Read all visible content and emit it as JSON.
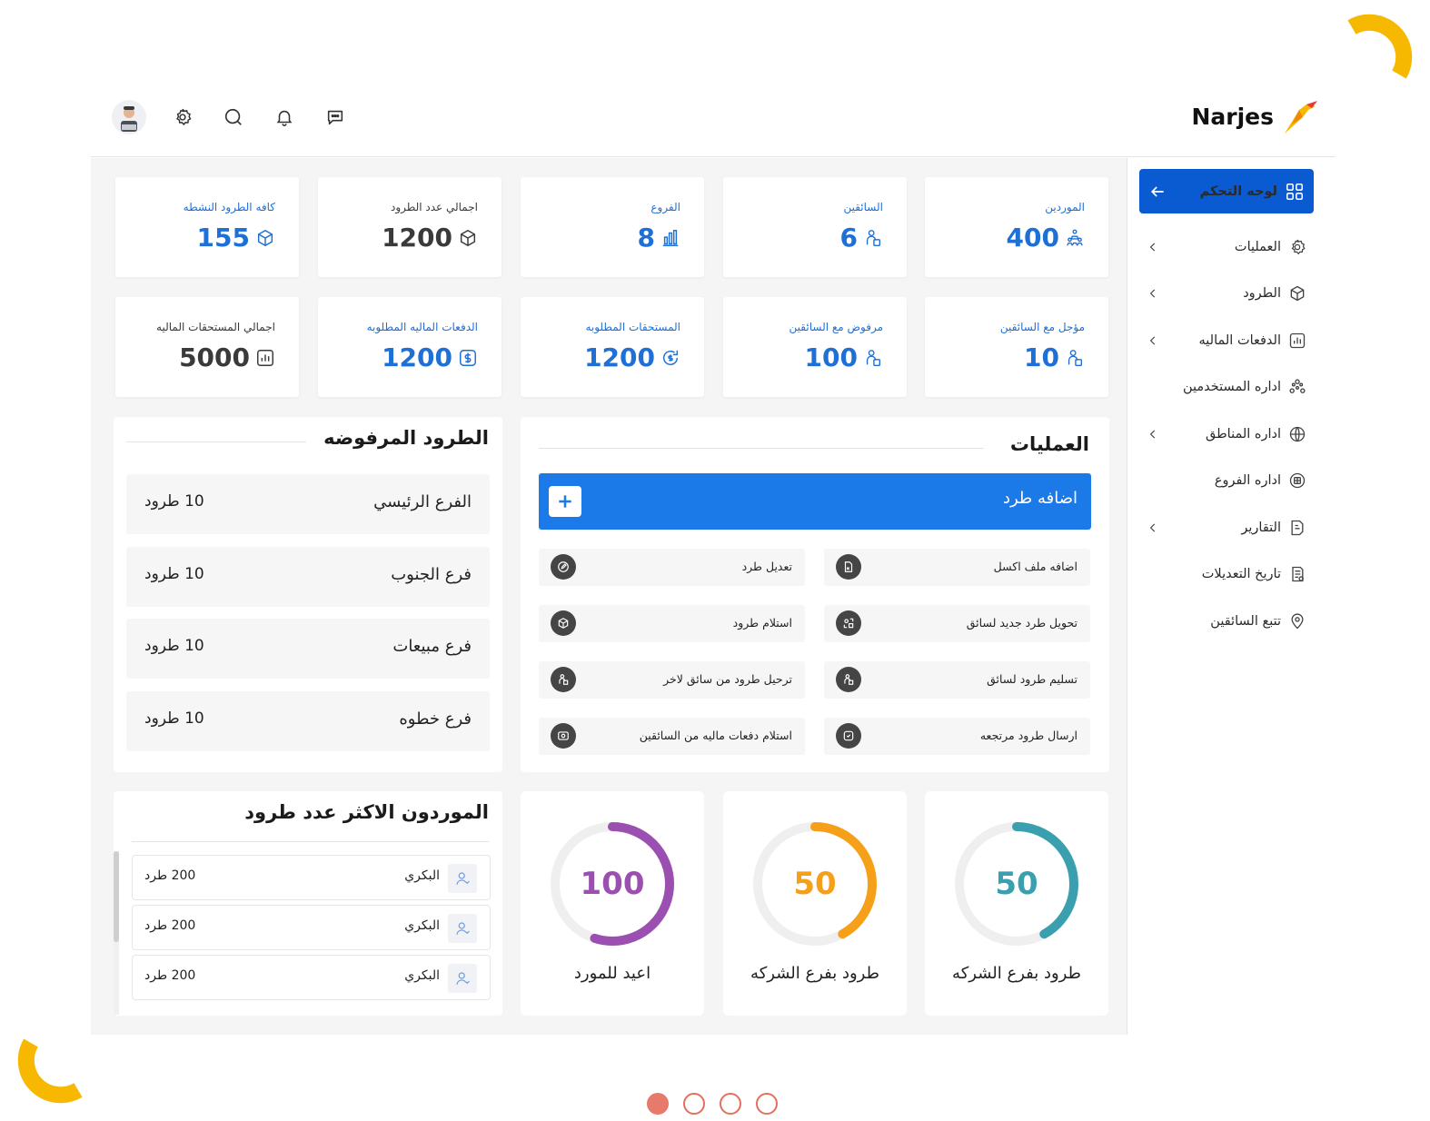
{
  "brand": {
    "name": "Narjes"
  },
  "header": {
    "icons": [
      "avatar",
      "gear-icon",
      "search-icon",
      "bell-icon",
      "chat-icon"
    ]
  },
  "colors": {
    "primary": "#0a5ad1",
    "button": "#1b7ae8",
    "stat_blue": "#1e6fd6",
    "teal": "#3aa0b0",
    "orange": "#f6a01a",
    "purple": "#9b4fb0",
    "accent_yellow": "#f6b800",
    "pager": "#e77a6a"
  },
  "sidebar": {
    "items": [
      {
        "label": "لوحه التحكم",
        "icon": "grid-icon",
        "active": true
      },
      {
        "label": "العمليات",
        "icon": "gear-icon",
        "has_children": true
      },
      {
        "label": "الطرود",
        "icon": "box-icon",
        "has_children": true
      },
      {
        "label": "الدفعات الماليه",
        "icon": "chart-icon",
        "has_children": true
      },
      {
        "label": "اداره المستخدمين",
        "icon": "users-icon",
        "has_children": false
      },
      {
        "label": "اداره المناطق",
        "icon": "globe-icon",
        "has_children": true
      },
      {
        "label": "اداره الفروع",
        "icon": "branch-icon",
        "has_children": false
      },
      {
        "label": "التقارير",
        "icon": "report-icon",
        "has_children": true
      },
      {
        "label": "تاريخ التعديلات",
        "icon": "history-icon",
        "has_children": false
      },
      {
        "label": "تتبع السائقين",
        "icon": "location-icon",
        "has_children": false
      }
    ]
  },
  "stats_row1": [
    {
      "title": "الموردين",
      "value": "400",
      "icon": "suppliers-icon"
    },
    {
      "title": "السائقين",
      "value": "6",
      "icon": "driver-icon"
    },
    {
      "title": "الفروع",
      "value": "8",
      "icon": "bars-icon"
    },
    {
      "title": "اجمالي عدد الطرود",
      "value": "1200",
      "icon": "box-icon"
    },
    {
      "title": "كافه الطرود النشطه",
      "value": "155",
      "icon": "box-icon"
    }
  ],
  "stats_row2": [
    {
      "title": "مؤجل مع السائقين",
      "value": "10",
      "icon": "driver-icon"
    },
    {
      "title": "مرفوض مع السائقين",
      "value": "100",
      "icon": "driver-icon"
    },
    {
      "title": "المستحقات المطلوبه",
      "value": "1200",
      "icon": "refresh-dollar-icon"
    },
    {
      "title": "الدفعات الماليه المطلوبه",
      "value": "1200",
      "icon": "dollar-icon"
    },
    {
      "title": "اجمالي المستحقات الماليه",
      "value": "5000",
      "icon": "chart-icon"
    }
  ],
  "operations": {
    "title": "العمليات",
    "add_label": "اضافه طرد",
    "items": [
      {
        "label": "اضافه ملف اكسل",
        "icon": "file-icon"
      },
      {
        "label": "تعديل طرد",
        "icon": "edit-icon"
      },
      {
        "label": "تحويل طرد جديد لسائق",
        "icon": "transfer-icon"
      },
      {
        "label": "استلام طرود",
        "icon": "box-icon"
      },
      {
        "label": "تسليم طرود لسائق",
        "icon": "driver-icon"
      },
      {
        "label": "ترحيل طرود من سائق لاخر",
        "icon": "driver-icon"
      },
      {
        "label": "ارسال طرود مرتجعه",
        "icon": "return-icon"
      },
      {
        "label": "استلام دفعات ماليه من السائقين",
        "icon": "money-icon"
      }
    ]
  },
  "rejected": {
    "title": "الطرود المرفوضه",
    "rows": [
      {
        "name": "الفرع الرئيسي",
        "count": "10 طرود"
      },
      {
        "name": "فرع الجنوب",
        "count": "10 طرود"
      },
      {
        "name": "فرع مبيعات",
        "count": "10 طرود"
      },
      {
        "name": "فرع خطوه",
        "count": "10 طرود"
      }
    ]
  },
  "top_suppliers": {
    "title": "الموردون الاكثر عدد طرود",
    "rows": [
      {
        "name": "البكري",
        "count": "200 طرد"
      },
      {
        "name": "البكري",
        "count": "200 طرد"
      },
      {
        "name": "البكري",
        "count": "200 طرد"
      }
    ]
  },
  "donuts": [
    {
      "label": "طرود بفرع الشركه",
      "value": "50",
      "fraction": 0.42,
      "color": "#3aa0b0"
    },
    {
      "label": "طرود بفرع الشركه",
      "value": "50",
      "fraction": 0.42,
      "color": "#f6a01a"
    },
    {
      "label": "اعيد للمورد",
      "value": "100",
      "fraction": 0.55,
      "color": "#9b4fb0"
    }
  ],
  "pager": {
    "pages": 4,
    "active": 1
  }
}
